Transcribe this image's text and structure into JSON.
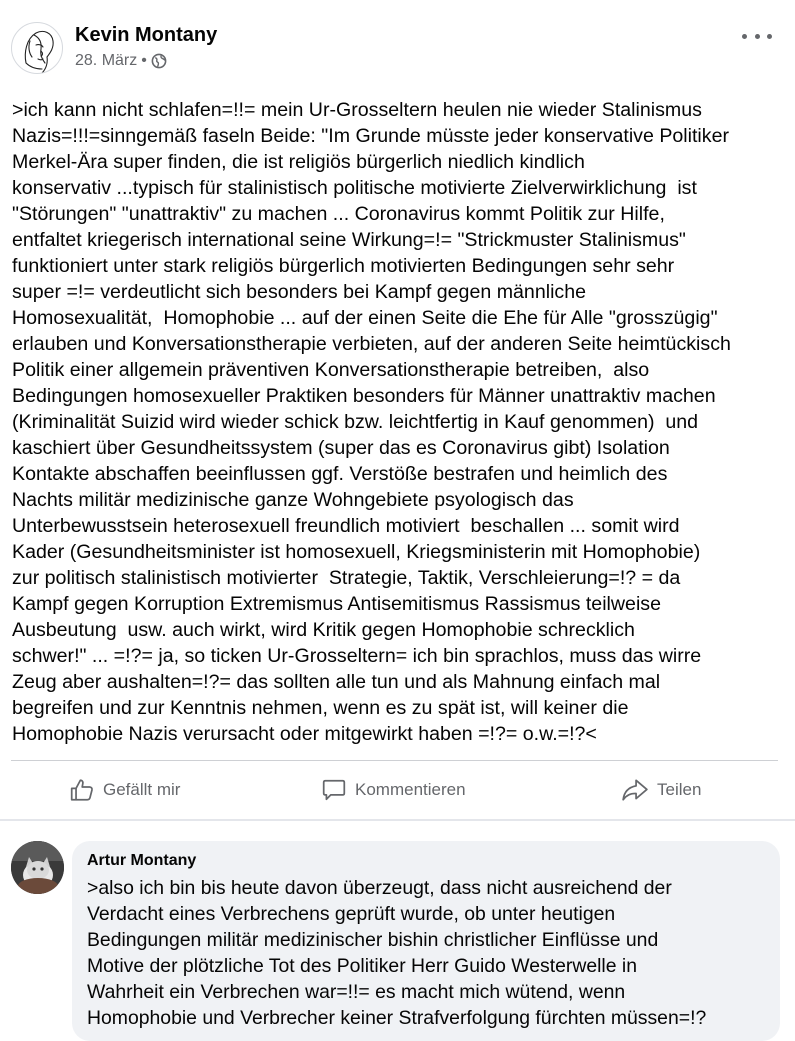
{
  "post": {
    "author": "Kevin Montany",
    "date": "28. März",
    "separator": "•",
    "audience_icon": "globe-icon",
    "more_icon": "more-horizontal-icon",
    "text_lines": [
      ">ich kann nicht schlafen=!!= mein Ur-Grosseltern heulen nie wieder Stalinismus",
      "Nazis=!!!=sinngemäß faseln Beide: \"Im Grunde müsste jeder konservative Politiker",
      "Merkel-Ära super finden, die ist religiös bürgerlich niedlich kindlich",
      "konservativ ...typisch für stalinistisch politische motivierte Zielverwirklichung  ist",
      "\"Störungen\" \"unattraktiv\" zu machen ... Coronavirus kommt Politik zur Hilfe,",
      "entfaltet kriegerisch international seine Wirkung=!= \"Strickmuster Stalinismus\"",
      "funktioniert unter stark religiös bürgerlich motivierten Bedingungen sehr sehr",
      "super =!= verdeutlicht sich besonders bei Kampf gegen männliche",
      "Homosexualität,  Homophobie ... auf der einen Seite die Ehe für Alle \"grosszügig\"",
      "erlauben und Konversationstherapie verbieten, auf der anderen Seite heimtückisch",
      "Politik einer allgemein präventiven Konversationstherapie betreiben,  also",
      "Bedingungen homosexueller Praktiken besonders für Männer unattraktiv machen",
      "(Kriminalität Suizid wird wieder schick bzw. leichtfertig in Kauf genommen)  und",
      "kaschiert über Gesundheitssystem (super das es Coronavirus gibt) Isolation",
      "Kontakte abschaffen beeinflussen ggf. Verstöße bestrafen und heimlich des",
      "Nachts militär medizinische ganze Wohngebiete psyologisch das",
      "Unterbewusstsein heterosexuell freundlich motiviert  beschallen ... somit wird",
      "Kader (Gesundheitsminister ist homosexuell, Kriegsministerin mit Homophobie)",
      "zur politisch stalinistisch motivierter  Strategie, Taktik, Verschleierung=!? = da",
      "Kampf gegen Korruption Extremismus Antisemitismus Rassismus teilweise",
      "Ausbeutung  usw. auch wirkt, wird Kritik gegen Homophobie schrecklich",
      "schwer!\" ... =!?= ja, so ticken Ur-Grosseltern= ich bin sprachlos, muss das wirre",
      "Zeug aber aushalten=!?= das sollten alle tun und als Mahnung einfach mal",
      "begreifen und zur Kenntnis nehmen, wenn es zu spät ist, will keiner die",
      "Homophobie Nazis verursacht oder mitgewirkt haben =!?= o.w.=!?<"
    ]
  },
  "actions": {
    "like": "Gefällt mir",
    "comment": "Kommentieren",
    "share": "Teilen"
  },
  "comment": {
    "author": "Artur Montany",
    "text_lines": [
      ">also ich bin bis heute davon überzeugt, dass nicht ausreichend der",
      "Verdacht eines Verbrechens geprüft wurde, ob unter heutigen",
      "Bedingungen militär medizinischer bishin christlicher Einflüsse und",
      "Motive der plötzliche Tot des Politiker Herr Guido Westerwelle in",
      "Wahrheit ein Verbrechen war=!!= es macht mich wütend, wenn",
      "Homophobie und Verbrecher keiner Strafverfolgung fürchten müssen=!?"
    ]
  },
  "colors": {
    "text": "#050505",
    "secondary_text": "#65676b",
    "divider": "#ced0d4",
    "bubble": "#f0f2f5"
  }
}
